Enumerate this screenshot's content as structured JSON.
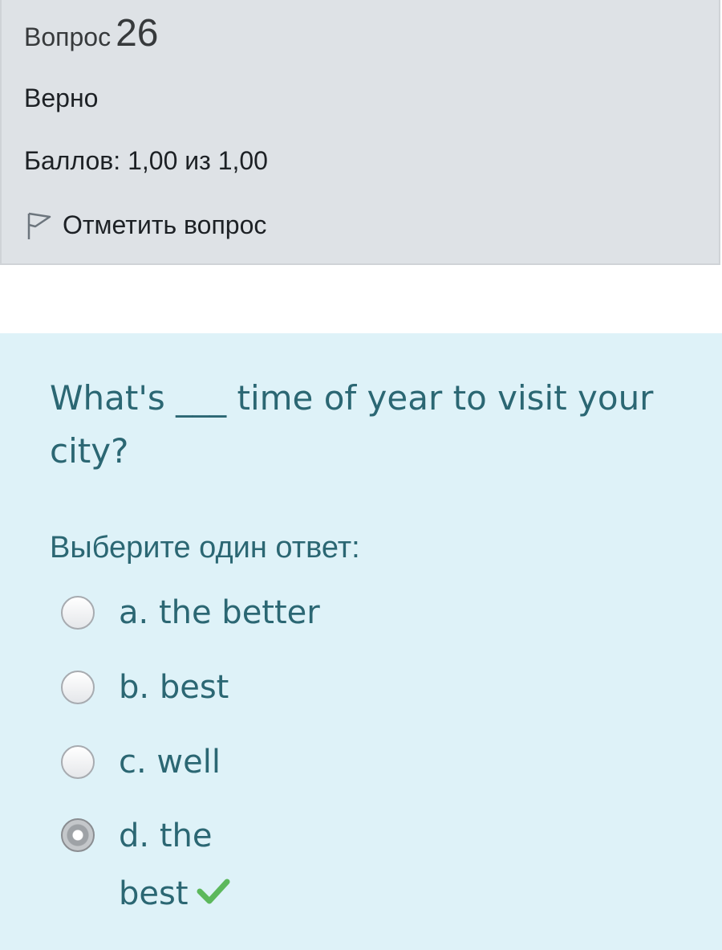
{
  "info": {
    "question_label": "Вопрос",
    "question_number": "26",
    "state": "Верно",
    "grade": "Баллов: 1,00 из 1,00",
    "flag_label": "Отметить вопрос"
  },
  "question": {
    "text": "What's ___ time of year to visit your city?",
    "prompt": "Выберите один ответ:",
    "options": [
      {
        "label": "a. the better",
        "selected": false
      },
      {
        "label": "b. best",
        "selected": false
      },
      {
        "label": "c. well",
        "selected": false
      },
      {
        "label": "d. the best",
        "selected": true,
        "correct": true
      }
    ]
  },
  "icons": {
    "flag": "flag-icon",
    "correct": "checkmark-icon"
  },
  "colors": {
    "info_bg": "#dee2e6",
    "content_bg": "#def2f8",
    "question_text": "#2b6773",
    "correct_green": "#5cb85c"
  }
}
